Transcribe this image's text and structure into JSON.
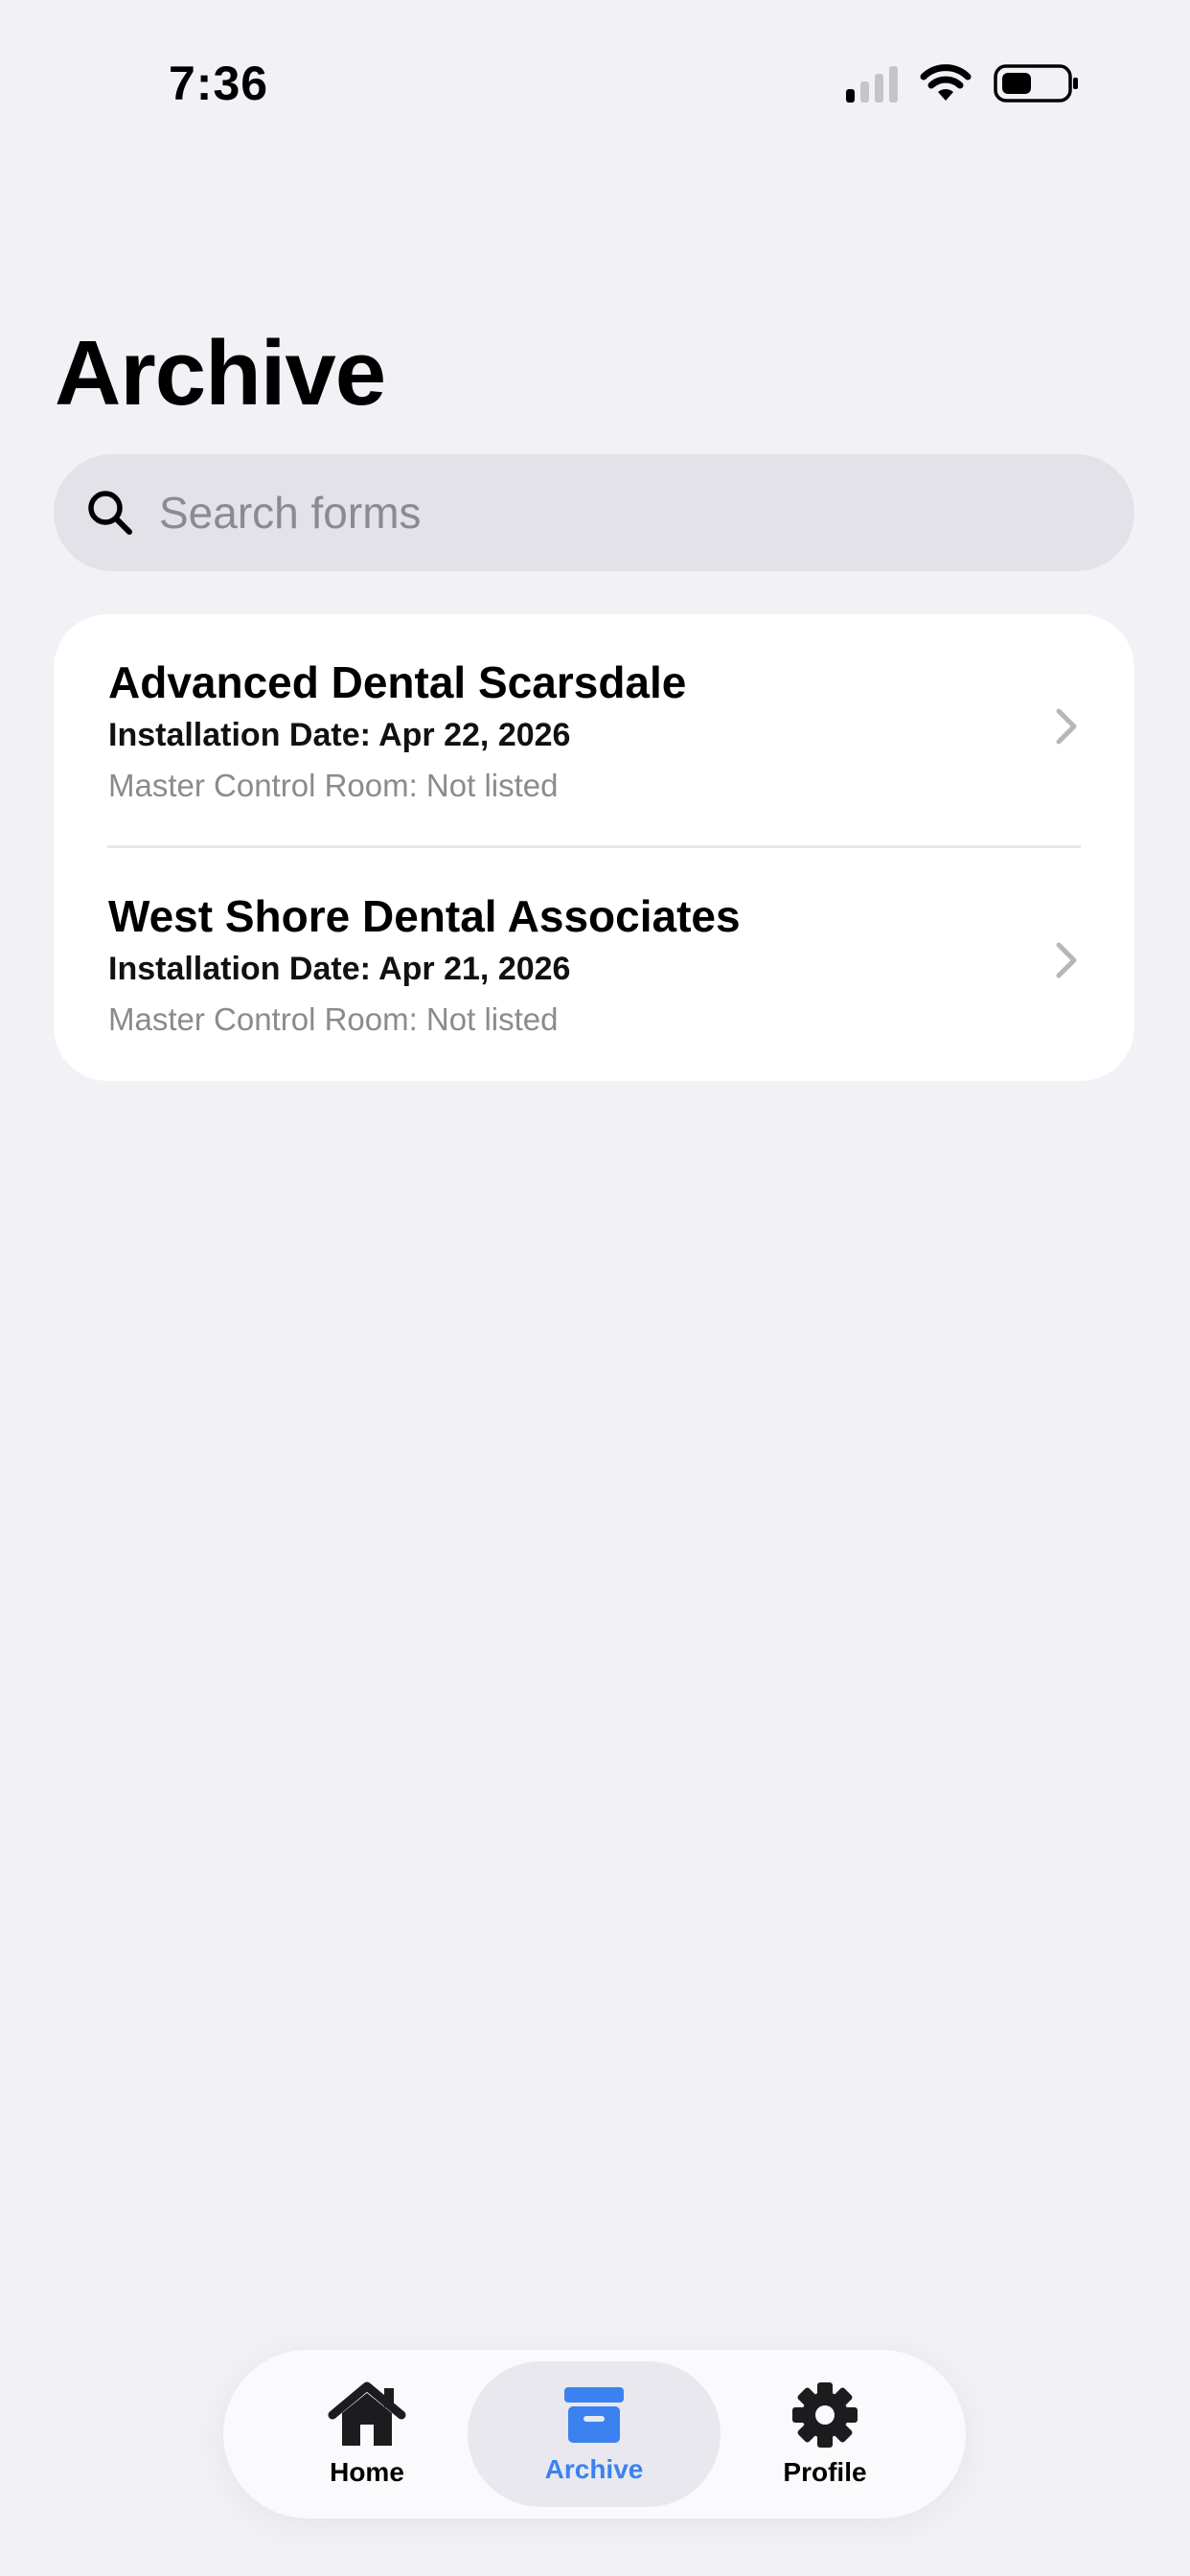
{
  "status_bar": {
    "time": "7:36",
    "icons": [
      "cellular-signal-icon",
      "wifi-icon",
      "battery-icon"
    ]
  },
  "page": {
    "title": "Archive"
  },
  "search": {
    "placeholder": "Search forms",
    "value": ""
  },
  "forms": [
    {
      "title": "Advanced Dental Scarsdale",
      "installation_date": "Installation Date: Apr 22, 2026",
      "master_control_room": "Master Control Room: Not listed"
    },
    {
      "title": "West Shore Dental Associates",
      "installation_date": "Installation Date: Apr 21, 2026",
      "master_control_room": "Master Control Room: Not listed"
    }
  ],
  "tab_bar": {
    "tabs": [
      {
        "label": "Home",
        "icon": "house-icon",
        "active": false
      },
      {
        "label": "Archive",
        "icon": "archive-box-icon",
        "active": true
      },
      {
        "label": "Profile",
        "icon": "gear-icon",
        "active": false
      }
    ]
  },
  "colors": {
    "background": "#f1f1f6",
    "accent": "#3b82f0",
    "card": "#ffffff",
    "search_fill": "#e2e2e8",
    "secondary_text": "#8b8b8f"
  }
}
